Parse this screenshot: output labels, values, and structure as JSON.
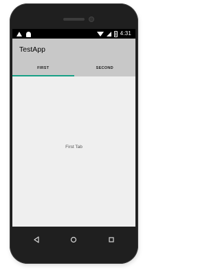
{
  "status_bar": {
    "time": "4:31",
    "left_icons": [
      "warning-icon",
      "android-icon"
    ],
    "right_icons": [
      "wifi-icon",
      "signal-icon",
      "battery-icon"
    ]
  },
  "app_bar": {
    "title": "TestApp",
    "background": "#c8c8c8"
  },
  "tabs": [
    {
      "label": "FIRST",
      "selected": true
    },
    {
      "label": "SECOND",
      "selected": false
    }
  ],
  "accent_color": "#17a086",
  "content": {
    "text": "First Tab"
  },
  "nav_bar": {
    "buttons": [
      "back-icon",
      "home-icon",
      "recent-apps-icon"
    ]
  }
}
